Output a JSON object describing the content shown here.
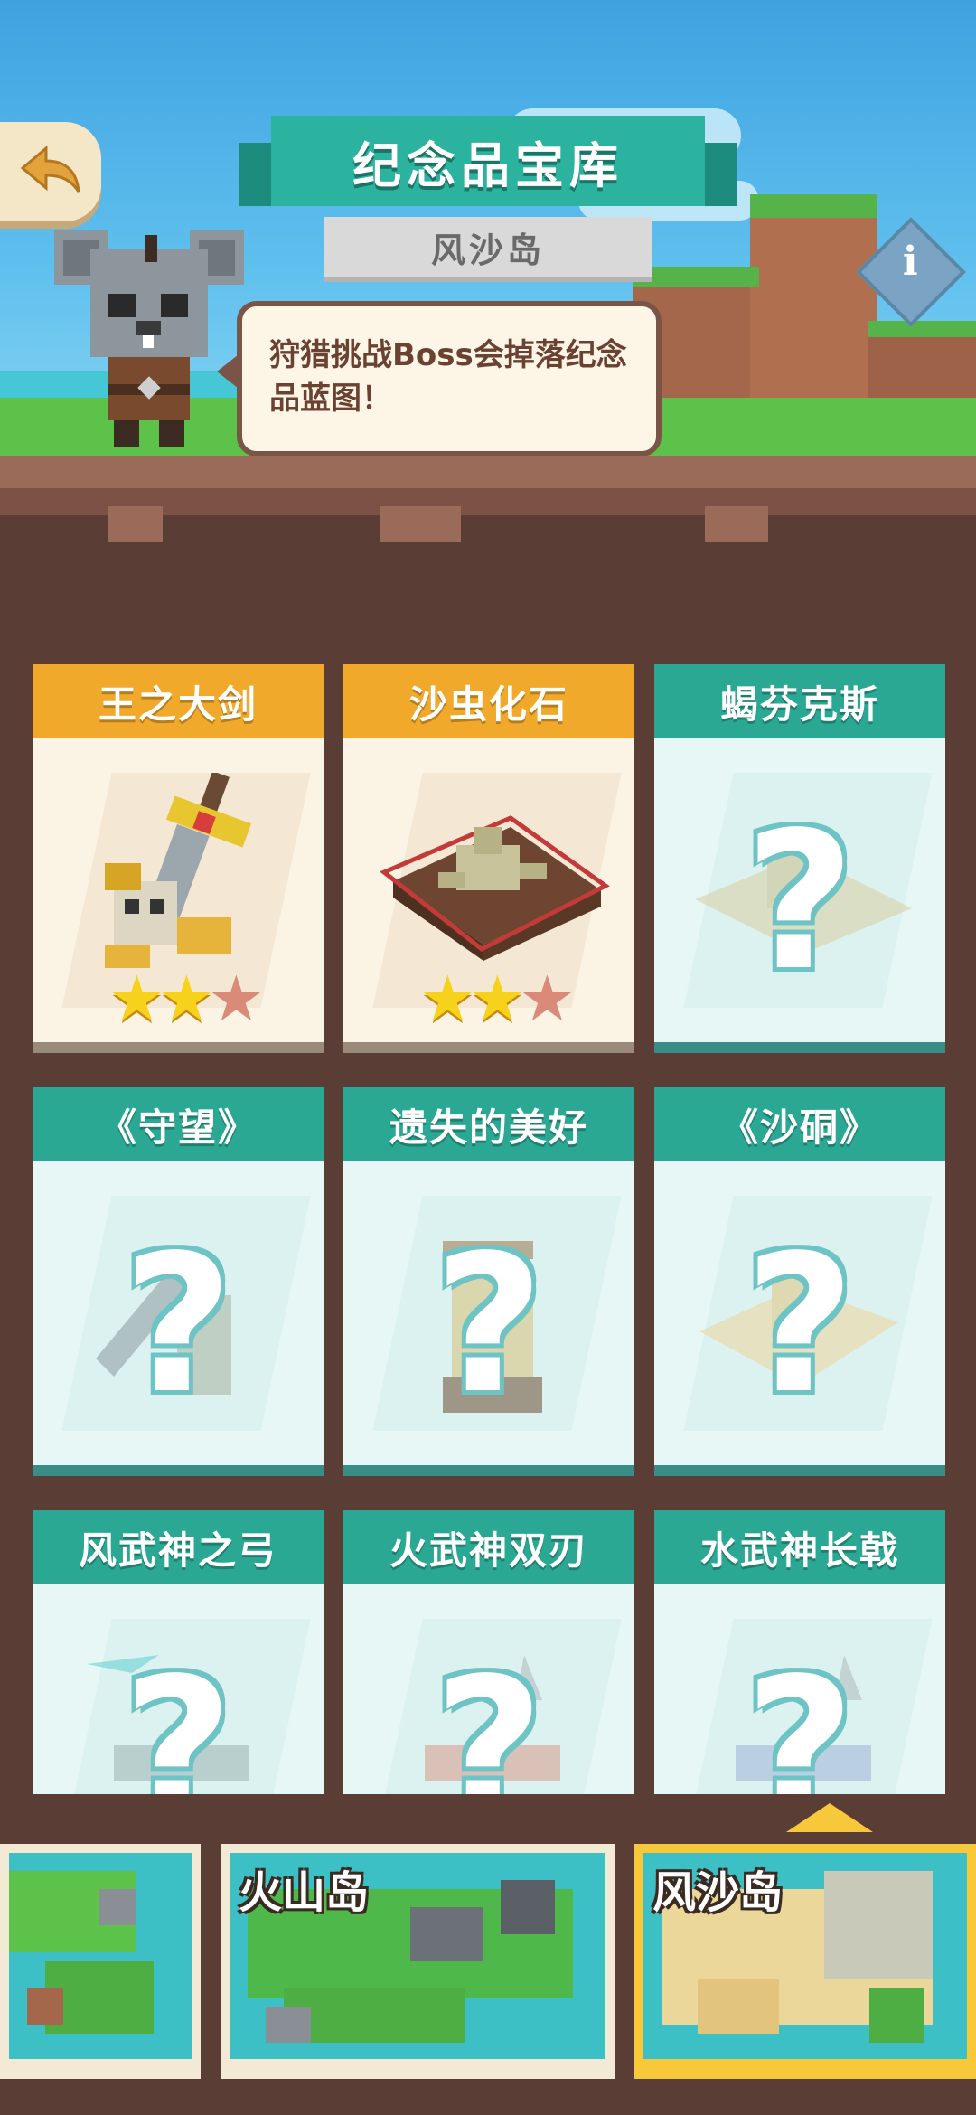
{
  "header": {
    "title": "纪念品宝库",
    "subtitle": "风沙岛"
  },
  "npc": {
    "speech": "狩猎挑战Boss会掉落纪念品蓝图！"
  },
  "icons": {
    "back": "back-arrow-icon",
    "info": "info-icon"
  },
  "cards": [
    {
      "title": "王之大剑",
      "status": "unlocked",
      "stars": 2,
      "max_stars": 3
    },
    {
      "title": "沙虫化石",
      "status": "unlocked",
      "stars": 2,
      "max_stars": 3
    },
    {
      "title": "蝎芬克斯",
      "status": "locked"
    },
    {
      "title": "《守望》",
      "status": "locked"
    },
    {
      "title": "遗失的美好",
      "status": "locked"
    },
    {
      "title": "《沙硐》",
      "status": "locked"
    },
    {
      "title": "风武神之弓",
      "status": "locked"
    },
    {
      "title": "火武神双刃",
      "status": "locked"
    },
    {
      "title": "水武神长戟",
      "status": "locked"
    }
  ],
  "locked_mark": "?",
  "islands": [
    {
      "name": "",
      "selected": false
    },
    {
      "name": "火山岛",
      "selected": false
    },
    {
      "name": "风沙岛",
      "selected": true
    }
  ],
  "colors": {
    "gold_header": "#f0a92a",
    "teal_header": "#2ba894",
    "brown_bg": "#5a3d35",
    "star_on": "#f7d21c",
    "star_off": "#d98a78"
  }
}
